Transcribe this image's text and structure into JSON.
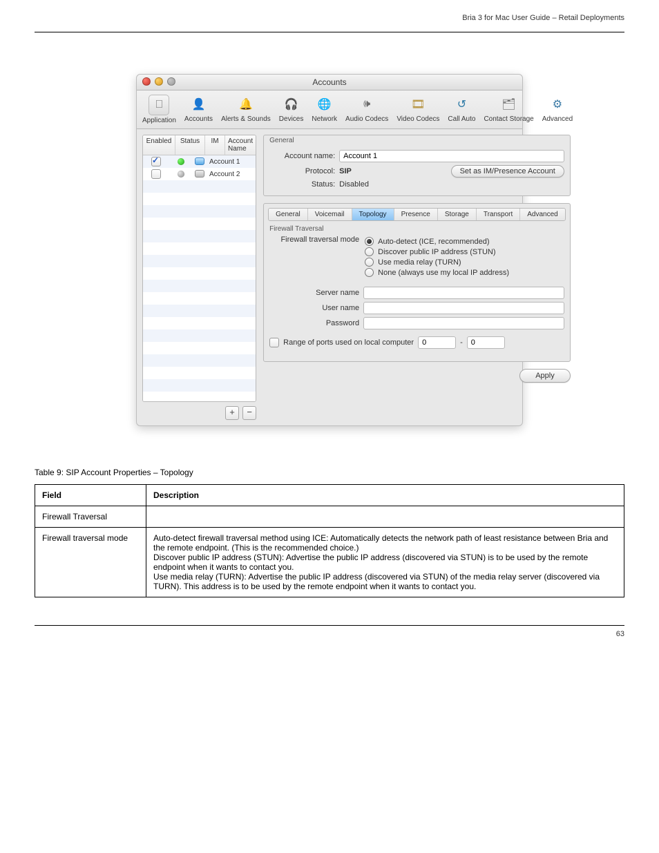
{
  "doc": {
    "header_right": "Bria 3 for Mac User Guide – Retail Deployments",
    "footer_page": "63",
    "table_caption": "Table 9: SIP Account Properties – Topology",
    "table": {
      "head": [
        "Field",
        "Description"
      ],
      "rows": [
        [
          "Firewall Traversal",
          ""
        ],
        [
          "Firewall traversal mode",
          "Auto-detect firewall traversal method using ICE: Automatically detects the network path of least resistance between Bria and the remote endpoint. (This is the recommended choice.)\nDiscover public IP address (STUN): Advertise the public IP address (discovered via STUN) is to be used by the remote endpoint when it wants to contact you.\nUse media relay (TURN): Advertise the public IP address (discovered via STUN) of the media relay server (discovered via TURN). This address is to be used by the remote endpoint when it wants to contact you."
        ]
      ]
    }
  },
  "win": {
    "title": "Accounts",
    "toolbar": [
      {
        "name": "application",
        "label": "Application",
        "glyph": "⎕"
      },
      {
        "name": "accounts",
        "label": "Accounts",
        "glyph": "👤"
      },
      {
        "name": "alerts-sounds",
        "label": "Alerts & Sounds",
        "glyph": "🔔"
      },
      {
        "name": "devices",
        "label": "Devices",
        "glyph": "🎧"
      },
      {
        "name": "network",
        "label": "Network",
        "glyph": "🌐"
      },
      {
        "name": "audio-codecs",
        "label": "Audio Codecs",
        "glyph": "🕪"
      },
      {
        "name": "video-codecs",
        "label": "Video Codecs",
        "glyph": "🎞"
      },
      {
        "name": "call-auto",
        "label": "Call Auto",
        "glyph": "↺"
      },
      {
        "name": "contact-storage",
        "label": "Contact Storage",
        "glyph": "🗂"
      },
      {
        "name": "advanced",
        "label": "Advanced",
        "glyph": "⚙"
      }
    ],
    "accounts_table": {
      "headers": {
        "enabled": "Enabled",
        "status": "Status",
        "im": "IM",
        "name": "Account Name"
      },
      "rows": [
        {
          "enabled": true,
          "status": "green",
          "im": "blue",
          "name": "Account 1"
        },
        {
          "enabled": false,
          "status": "gray",
          "im": "gray",
          "name": "Account 2"
        }
      ],
      "add": "+",
      "remove": "−"
    },
    "general": {
      "title": "General",
      "account_name_label": "Account name:",
      "account_name_value": "Account 1",
      "protocol_label": "Protocol:",
      "protocol_value": "SIP",
      "status_label": "Status:",
      "status_value": "Disabled",
      "set_im_btn": "Set as IM/Presence Account"
    },
    "tabs": [
      "General",
      "Voicemail",
      "Topology",
      "Presence",
      "Storage",
      "Transport",
      "Advanced"
    ],
    "active_tab": "Topology",
    "topology": {
      "subsection": "Firewall Traversal",
      "mode_label": "Firewall traversal mode",
      "options": [
        "Auto-detect (ICE, recommended)",
        "Discover public IP address (STUN)",
        "Use media relay (TURN)",
        "None (always use my local IP address)"
      ],
      "selected": 0,
      "server_label": "Server name",
      "user_label": "User name",
      "pass_label": "Password",
      "port_check_label": "Range of ports used on local computer",
      "port_from": "0",
      "port_dash": "-",
      "port_to": "0"
    },
    "apply": "Apply"
  }
}
